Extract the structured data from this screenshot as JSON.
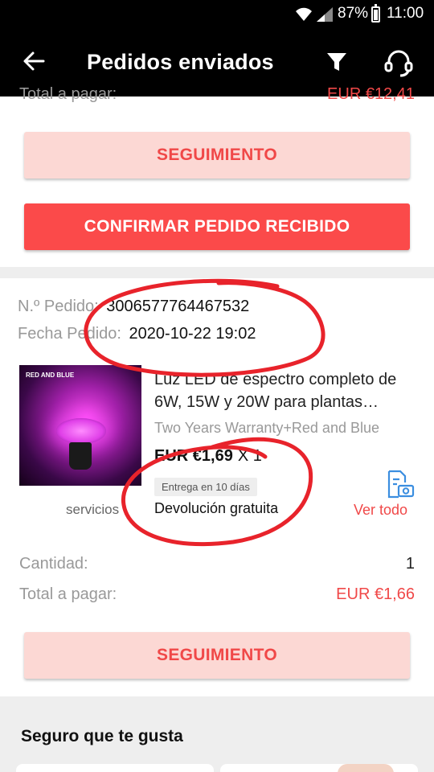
{
  "status_bar": {
    "battery": "87%",
    "time": "11:00"
  },
  "app_bar": {
    "title": "Pedidos enviados"
  },
  "previous_order": {
    "total_label": "Total a pagar:",
    "total_value": "EUR €12,41",
    "tracking_button": "SEGUIMIENTO",
    "confirm_button": "CONFIRMAR PEDIDO RECIBIDO"
  },
  "order": {
    "number_label": "N.º Pedido:",
    "number_value": "3006577764467532",
    "date_label": "Fecha Pedido:",
    "date_value": "2020-10-22 19:02",
    "product": {
      "thumb_caption": "RED AND BLUE",
      "title": "Luz LED de espectro completo de 6W, 15W y 20W para plantas…",
      "variant": "Two Years Warranty+Red and Blue",
      "price": "EUR €1,69",
      "qty_x": "X 1",
      "delivery_badge": "Entrega en 10 días",
      "free_return": "Devolución gratuita",
      "services_label": "servicios",
      "see_all": "Ver todo"
    },
    "quantity_label": "Cantidad:",
    "quantity_value": "1",
    "total_label": "Total a pagar:",
    "total_value": "EUR €1,66",
    "tracking_button": "SEGUIMIENTO"
  },
  "recommendations": {
    "title": "Seguro que te gusta"
  },
  "colors": {
    "accent": "#f04848",
    "button_red": "#fb4a4a",
    "button_light": "#fcd8d4",
    "annotation": "#e8232b"
  },
  "icons": [
    "wifi-icon",
    "signal-icon",
    "battery-icon",
    "back-arrow-icon",
    "filter-icon",
    "customer-service-icon",
    "document-camera-icon"
  ]
}
